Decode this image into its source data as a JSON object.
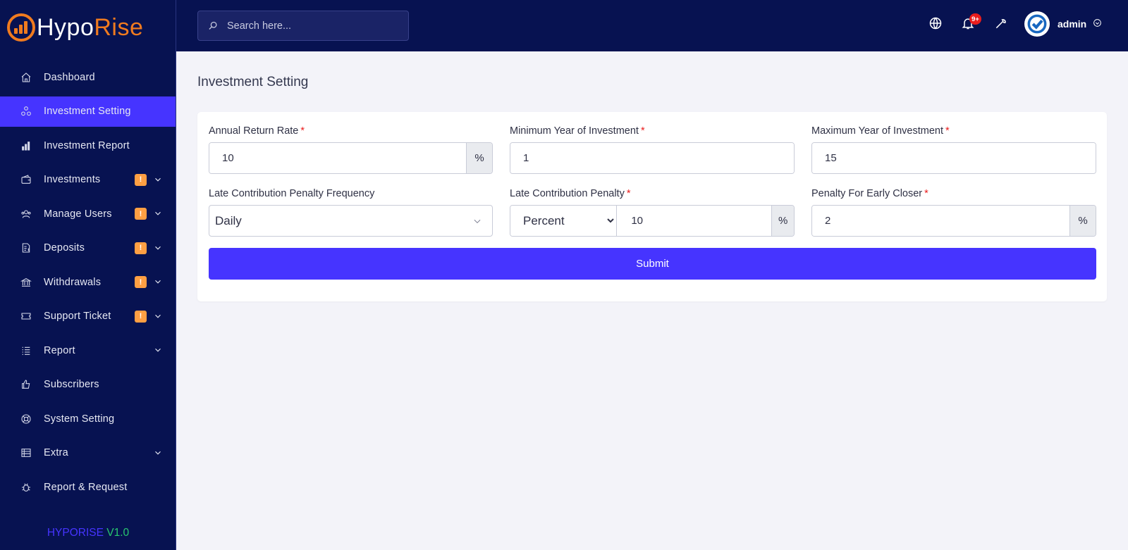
{
  "brand": {
    "name_part1": "Hypo",
    "name_part2": "Rise"
  },
  "sidebar": {
    "items": [
      {
        "label": "Dashboard",
        "icon": "home-icon",
        "active": false,
        "badge": "",
        "caret": false
      },
      {
        "label": "Investment Setting",
        "icon": "nodes-icon",
        "active": true,
        "badge": "",
        "caret": false
      },
      {
        "label": "Investment Report",
        "icon": "bar-chart-icon",
        "active": false,
        "badge": "",
        "caret": false
      },
      {
        "label": "Investments",
        "icon": "wallet-icon",
        "active": false,
        "badge": "!",
        "caret": true
      },
      {
        "label": "Manage Users",
        "icon": "users-icon",
        "active": false,
        "badge": "!",
        "caret": true
      },
      {
        "label": "Deposits",
        "icon": "receipt-icon",
        "active": false,
        "badge": "!",
        "caret": true
      },
      {
        "label": "Withdrawals",
        "icon": "bank-icon",
        "active": false,
        "badge": "!",
        "caret": true
      },
      {
        "label": "Support Ticket",
        "icon": "ticket-icon",
        "active": false,
        "badge": "!",
        "caret": true
      },
      {
        "label": "Report",
        "icon": "list-icon",
        "active": false,
        "badge": "",
        "caret": true
      },
      {
        "label": "Subscribers",
        "icon": "thumbs-up-icon",
        "active": false,
        "badge": "",
        "caret": false
      },
      {
        "label": "System Setting",
        "icon": "lifebuoy-icon",
        "active": false,
        "badge": "",
        "caret": false
      },
      {
        "label": "Extra",
        "icon": "server-icon",
        "active": false,
        "badge": "",
        "caret": true
      },
      {
        "label": "Report & Request",
        "icon": "bug-icon",
        "active": false,
        "badge": "",
        "caret": false
      }
    ],
    "version_name": "HYPORISE",
    "version_number": "V1.0"
  },
  "topbar": {
    "search_placeholder": "Search here...",
    "notification_count": "9+",
    "user_name": "admin"
  },
  "page": {
    "title": "Investment Setting",
    "fields": {
      "annual_return_rate": {
        "label": "Annual Return Rate",
        "required": "*",
        "value": "10",
        "addon": "%"
      },
      "min_year": {
        "label": "Minimum Year of Investment",
        "required": "*",
        "value": "1"
      },
      "max_year": {
        "label": "Maximum Year of Investment",
        "required": "*",
        "value": "15"
      },
      "penalty_frequency": {
        "label": "Late Contribution Penalty Frequency",
        "value": "Daily"
      },
      "late_penalty": {
        "label": "Late Contribution Penalty",
        "required": "*",
        "type_value": "Percent",
        "value": "10",
        "addon": "%"
      },
      "early_closer": {
        "label": "Penalty For Early Closer",
        "required": "*",
        "value": "2",
        "addon": "%"
      }
    },
    "submit_label": "Submit"
  },
  "colors": {
    "sidebar_bg": "#071251",
    "accent": "#4634ff",
    "brand_orange": "#f07b1f",
    "badge_warning": "#ff9f43",
    "notification_red": "#ea1d1d",
    "version_green": "#28c76f"
  }
}
